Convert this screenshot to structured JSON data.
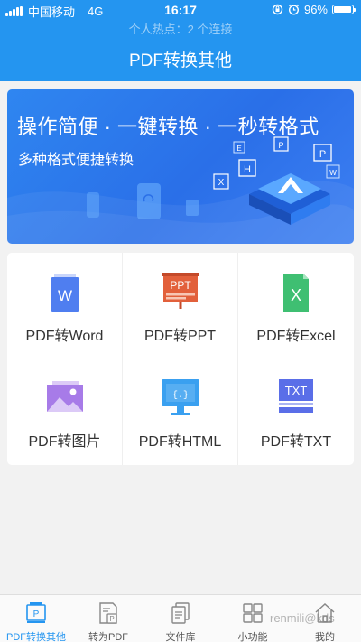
{
  "status_bar": {
    "carrier": "中国移动",
    "network": "4G",
    "time": "16:17",
    "battery_percent": "96%",
    "battery_level": 0.96
  },
  "hotspot_text": "个人热点：2 个连接",
  "header": {
    "title": "PDF转换其他"
  },
  "banner": {
    "title": "操作简便 · 一键转换 · 一秒转格式",
    "subtitle": "多种格式便捷转换",
    "badge_letters": [
      "E",
      "P",
      "H",
      "P",
      "X",
      "W"
    ]
  },
  "tools": [
    {
      "label": "PDF转Word",
      "icon": "word-doc-icon",
      "glyph": "W",
      "color": "#4f7ef0"
    },
    {
      "label": "PDF转PPT",
      "icon": "ppt-board-icon",
      "glyph": "PPT",
      "color": "#e2603b"
    },
    {
      "label": "PDF转Excel",
      "icon": "excel-doc-icon",
      "glyph": "X",
      "color": "#3fbf72"
    },
    {
      "label": "PDF转图片",
      "icon": "image-icon",
      "glyph": "",
      "color": "#a77be8"
    },
    {
      "label": "PDF转HTML",
      "icon": "html-monitor-icon",
      "glyph": "{.}",
      "color": "#3aa0f0"
    },
    {
      "label": "PDF转TXT",
      "icon": "txt-doc-icon",
      "glyph": "TXT",
      "color": "#5a6ee8"
    }
  ],
  "tabs": [
    {
      "label": "PDF转换其他",
      "icon": "pdf-convert-icon",
      "glyph": "P",
      "active": true
    },
    {
      "label": "转为PDF",
      "icon": "to-pdf-icon",
      "glyph": "P",
      "active": false
    },
    {
      "label": "文件库",
      "icon": "file-library-icon",
      "active": false
    },
    {
      "label": "小功能",
      "icon": "grid-tools-icon",
      "active": false
    },
    {
      "label": "我的",
      "icon": "home-profile-icon",
      "active": false
    }
  ],
  "watermark": "renmili@kds",
  "colors": {
    "primary": "#2495f0",
    "background": "#f2f2f2"
  }
}
